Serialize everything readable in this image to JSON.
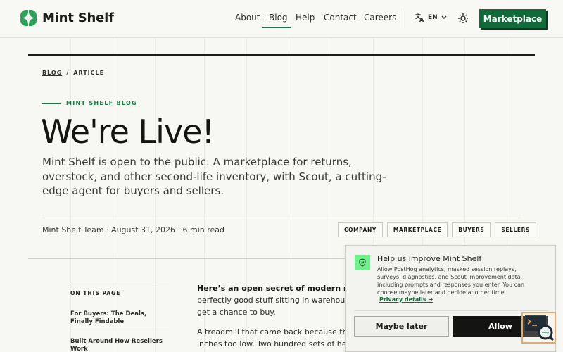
{
  "header": {
    "brand": "Mint Shelf",
    "nav": [
      {
        "label": "About"
      },
      {
        "label": "Blog",
        "active": true
      },
      {
        "label": "Help"
      },
      {
        "label": "Contact"
      },
      {
        "label": "Careers"
      }
    ],
    "language": "EN",
    "language_icon": "translate-icon",
    "theme_icon": "sun-icon",
    "cta_label": "Marketplace",
    "accent_color": "#0f6b37"
  },
  "breadcrumb": {
    "root": "BLOG",
    "separator": "/",
    "current": "ARTICLE"
  },
  "article": {
    "eyebrow": "MINT SHELF BLOG",
    "title": "We're Live!",
    "subtitle": "Mint Shelf is open to the public. A marketplace for returns, overstock, and other second-life inventory, with Scout, a cutting-edge agent for buyers and sellers.",
    "meta": "Mint Shelf Team · August 31, 2026 · 6 min read",
    "tags": [
      "COMPANY",
      "MARKETPLACE",
      "BUYERS",
      "SELLERS"
    ],
    "body_lead": "Here’s an open secret of modern ret",
    "body_rest": "perfectly good stuff sitting in warehouse get a chance to buy.",
    "body_p2_line1": "A treadmill that came back because the",
    "body_p2_line2": "inches too low. Two hundred sets of headphones from a canceled retail order. A"
  },
  "toc": {
    "heading": "ON THIS PAGE",
    "items": [
      "For Buyers: The Deals, Finally Findable",
      "Built Around How Resellers Work"
    ]
  },
  "consent": {
    "icon": "shield-check-icon",
    "title": "Help us improve Mint Shelf",
    "description": "Allow PostHog analytics, masked session replays, surveys, diagnostics, and Scout improvement data, including prompts and responses you enter. You can choose maybe later and decide another time.",
    "link": "Privacy details →",
    "decline_label": "Maybe later",
    "accept_label": "Allow"
  },
  "scout_badge_icon": "scout-search-icon"
}
